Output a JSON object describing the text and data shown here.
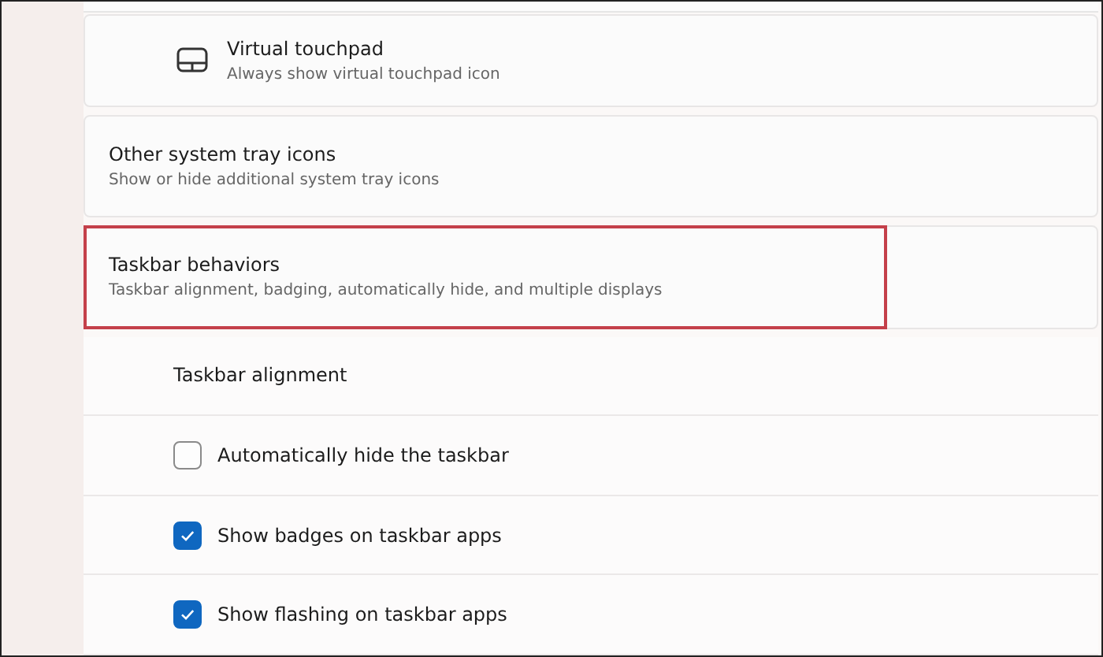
{
  "cards": [
    {
      "kind": "icon-item",
      "title": "Virtual touchpad",
      "subtitle": "Always show virtual touchpad icon",
      "highlighted": false
    },
    {
      "kind": "section",
      "title": "Other system tray icons",
      "subtitle": "Show or hide additional system tray icons",
      "highlighted": false
    },
    {
      "kind": "section",
      "title": "Taskbar behaviors",
      "subtitle": "Taskbar alignment, badging, automatically hide, and multiple displays",
      "highlighted": true
    }
  ],
  "options": [
    {
      "kind": "label",
      "label": "Taskbar alignment"
    },
    {
      "kind": "checkbox",
      "label": "Automatically hide the taskbar",
      "checked": false
    },
    {
      "kind": "checkbox",
      "label": "Show badges on taskbar apps",
      "checked": true
    },
    {
      "kind": "checkbox",
      "label": "Show flashing on taskbar apps",
      "checked": true
    }
  ]
}
